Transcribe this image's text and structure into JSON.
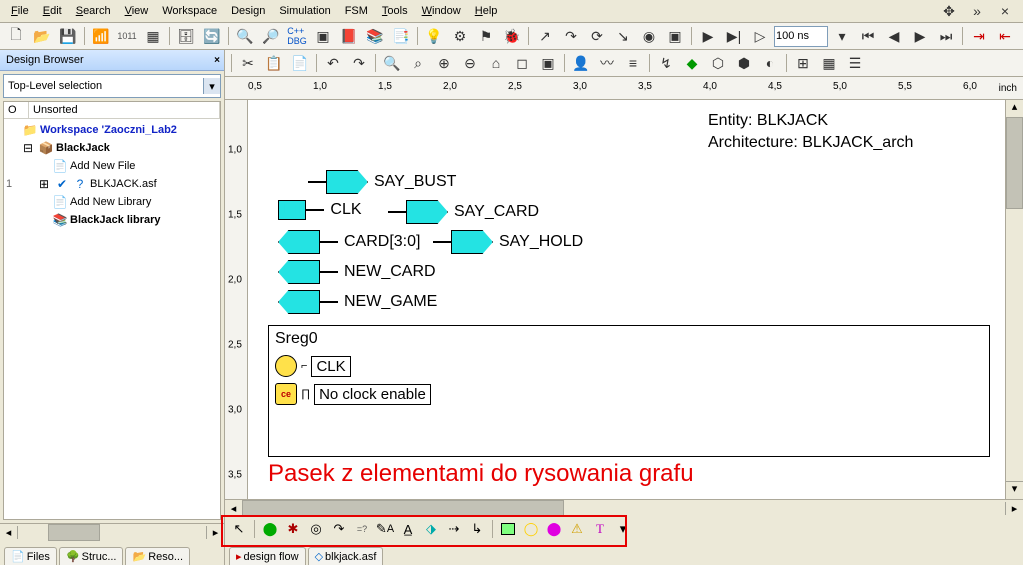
{
  "menu": {
    "file": "File",
    "edit": "Edit",
    "search": "Search",
    "view": "View",
    "workspace": "Workspace",
    "design": "Design",
    "simulation": "Simulation",
    "fsm": "FSM",
    "tools": "Tools",
    "window": "Window",
    "help": "Help"
  },
  "toolbar1": {
    "time_value": "100 ns"
  },
  "design_browser": {
    "title": "Design Browser",
    "combo": "Top-Level selection",
    "col_o": "O",
    "col_name": "Unsorted",
    "nodes": {
      "workspace": "Workspace 'Zaoczni_Lab2",
      "project": "BlackJack",
      "addfile": "Add New File",
      "asf": "BLKJACK.asf",
      "addlib": "Add New Library",
      "lib": "BlackJack library",
      "row_num": "1"
    },
    "tabs": {
      "files": "Files",
      "struc": "Struc...",
      "reso": "Reso..."
    }
  },
  "ruler": {
    "h": [
      "0,5",
      "1,0",
      "1,5",
      "2,0",
      "2,5",
      "3,0",
      "3,5",
      "4,0",
      "4,5",
      "5,0",
      "5,5",
      "6,0"
    ],
    "v": [
      "1,0",
      "1,5",
      "2,0",
      "2,5",
      "3,0",
      "3,5"
    ],
    "unit": "inch"
  },
  "canvas": {
    "entity_line": "Entity: BLKJACK",
    "arch_line": "Architecture: BLKJACK_arch",
    "ports": {
      "say_bust": "SAY_BUST",
      "clk": "CLK",
      "say_card": "SAY_CARD",
      "card": "CARD[3:0]",
      "say_hold": "SAY_HOLD",
      "new_card": "NEW_CARD",
      "new_game": "NEW_GAME"
    },
    "sreg": {
      "title": "Sreg0",
      "clk": "CLK",
      "noce": "No clock enable",
      "ce": "ce"
    },
    "annotation": "Pasek z elementami do rysowania grafu"
  },
  "bottom_tabs": {
    "design_flow": "design flow",
    "blkjack": "blkjack.asf"
  }
}
